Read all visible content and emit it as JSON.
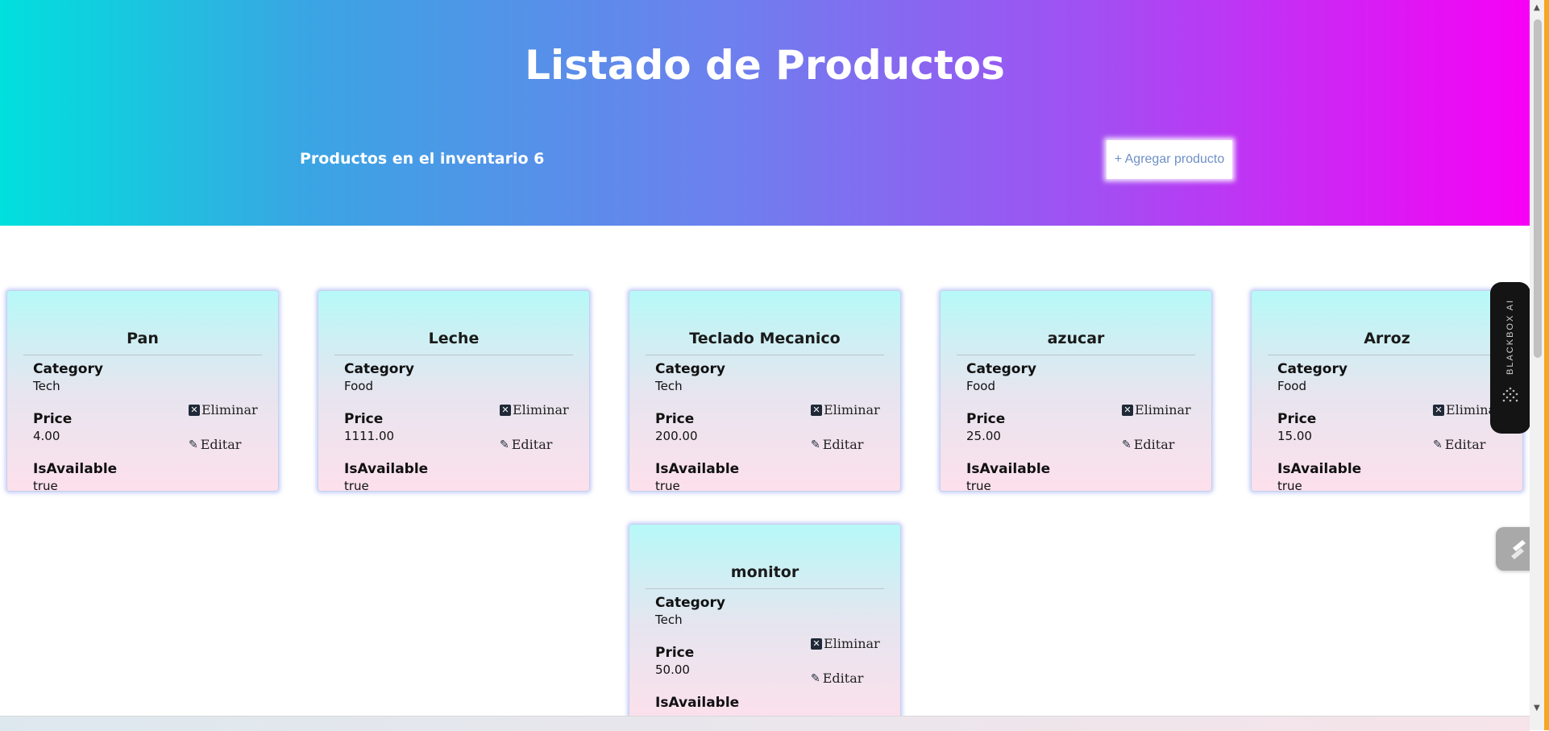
{
  "header": {
    "title": "Listado de Productos",
    "inventory_label": "Productos en el inventario 6",
    "add_button_label": "+ Agregar producto"
  },
  "labels": {
    "category": "Category",
    "price": "Price",
    "is_available": "IsAvailable",
    "delete": "Eliminar",
    "edit": "Editar"
  },
  "products": [
    {
      "name": "Pan",
      "category": "Tech",
      "price": "4.00",
      "available": "true"
    },
    {
      "name": "Leche",
      "category": "Food",
      "price": "1111.00",
      "available": "true"
    },
    {
      "name": "Teclado Mecanico",
      "category": "Tech",
      "price": "200.00",
      "available": "true"
    },
    {
      "name": "azucar",
      "category": "Food",
      "price": "25.00",
      "available": "true"
    },
    {
      "name": "Arroz",
      "category": "Food",
      "price": "15.00",
      "available": "true"
    },
    {
      "name": "monitor",
      "category": "Tech",
      "price": "50.00",
      "available": "true"
    }
  ],
  "widgets": {
    "blackbox_label": "BLACKBOX AI"
  },
  "colors": {
    "header_gradient": [
      "#00e0dd",
      "#3aa5e3",
      "#6e7fee",
      "#a34ef3",
      "#f700f5"
    ],
    "card_gradient": [
      "#b7f9f8",
      "#e6e5ef",
      "#fde0ec"
    ],
    "add_button_text": "#6f8fc7"
  },
  "icons": [
    "close-box-icon",
    "pencil-icon",
    "blackbox-logo-icon",
    "brush-icon"
  ]
}
